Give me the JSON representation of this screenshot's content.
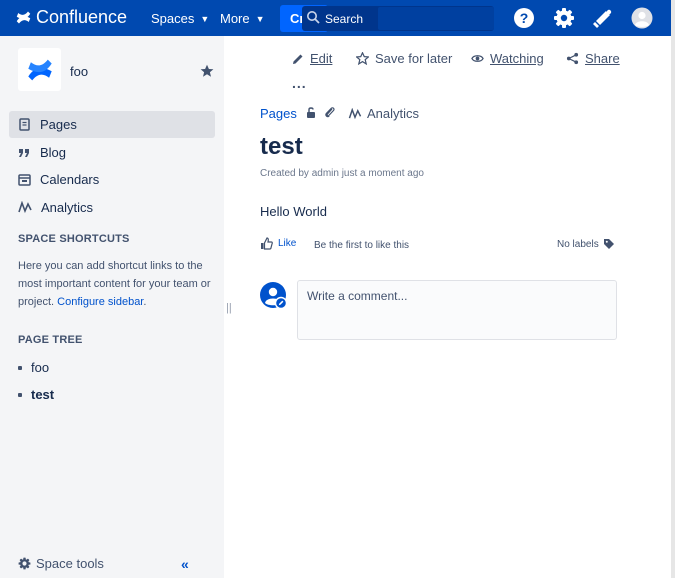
{
  "app": {
    "name": "Confluence"
  },
  "topnav": {
    "spaces": "Spaces",
    "more": "More",
    "create": "Create",
    "search_label": "Search"
  },
  "sidebar": {
    "space_name": "foo",
    "nav": [
      {
        "label": "Pages",
        "icon": "pages-icon",
        "active": true
      },
      {
        "label": "Blog",
        "icon": "quote-icon"
      },
      {
        "label": "Calendars",
        "icon": "calendar-icon"
      },
      {
        "label": "Analytics",
        "icon": "analytics-icon"
      }
    ],
    "shortcuts_heading": "SPACE SHORTCUTS",
    "shortcuts_text": "Here you can add shortcut links to the most important content for your team or project.",
    "configure_link": "Configure sidebar",
    "tree_heading": "PAGE TREE",
    "tree": [
      {
        "label": "foo"
      },
      {
        "label": "test",
        "current": true
      }
    ],
    "space_tools": "Space tools",
    "collapse": "«"
  },
  "actions": {
    "edit": "Edit",
    "save_later": "Save for later",
    "watching": "Watching",
    "share": "Share",
    "more": "..."
  },
  "breadcrumb": {
    "pages": "Pages",
    "analytics": "Analytics"
  },
  "page": {
    "title": "test",
    "byline": "Created by admin just a moment ago",
    "body": "Hello World"
  },
  "footer": {
    "like": "Like",
    "like_hint": "Be the first to like this",
    "labels": "No labels"
  },
  "comment": {
    "placeholder": "Write a comment..."
  },
  "colors": {
    "header": "#0049b0",
    "accent": "#0052cc",
    "sidebar_bg": "#f4f5f7"
  }
}
